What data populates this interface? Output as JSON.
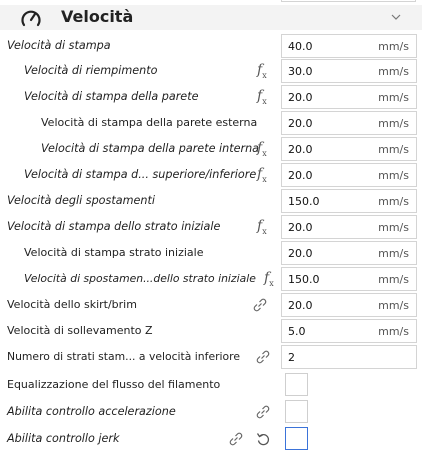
{
  "section": {
    "title": "Velocità",
    "icon": "speedometer-icon",
    "collapse_icon": "chevron-down-icon"
  },
  "settings": [
    {
      "label": "Velocità di stampa",
      "value": "40.0",
      "unit": "mm/s"
    },
    {
      "label": "Velocità di riempimento",
      "value": "30.0",
      "unit": "mm/s"
    },
    {
      "label": "Velocità di stampa della parete",
      "value": "20.0",
      "unit": "mm/s"
    },
    {
      "label": "Velocità di stampa della parete esterna",
      "value": "20.0",
      "unit": "mm/s"
    },
    {
      "label": "Velocità di stampa della parete interna",
      "value": "20.0",
      "unit": "mm/s"
    },
    {
      "label": "Velocità di stampa d... superiore/inferiore",
      "value": "20.0",
      "unit": "mm/s"
    },
    {
      "label": "Velocità degli spostamenti",
      "value": "150.0",
      "unit": "mm/s"
    },
    {
      "label": "Velocità di stampa dello strato iniziale",
      "value": "20.0",
      "unit": "mm/s"
    },
    {
      "label": "Velocità di stampa strato iniziale",
      "value": "20.0",
      "unit": "mm/s"
    },
    {
      "label": "Velocità di spostamen...dello strato iniziale",
      "value": "150.0",
      "unit": "mm/s"
    },
    {
      "label": "Velocità dello skirt/brim",
      "value": "20.0",
      "unit": "mm/s"
    },
    {
      "label": "Velocità di sollevamento Z",
      "value": "5.0",
      "unit": "mm/s"
    },
    {
      "label": "Numero di strati stam... a velocità inferiore",
      "value": "2",
      "unit": ""
    },
    {
      "label": "Equalizzazione del flusso del filamento",
      "checked": false
    },
    {
      "label": "Abilita controllo accelerazione",
      "checked": false
    },
    {
      "label": "Abilita controllo jerk",
      "checked": false
    }
  ],
  "colors": {
    "header_bg": "#f3f3f3",
    "focus_border": "#3b73d9"
  }
}
